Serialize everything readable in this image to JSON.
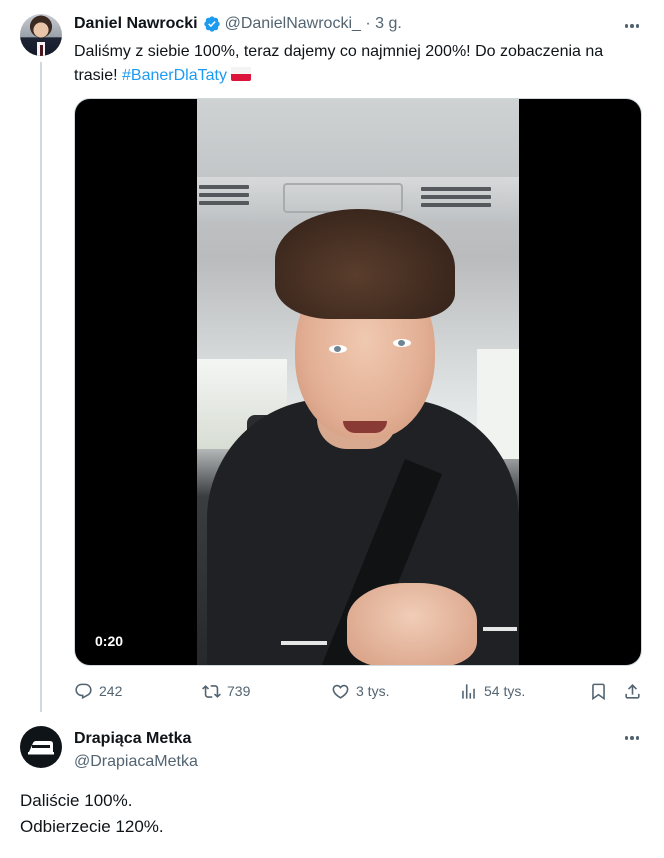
{
  "tweet": {
    "author_name": "Daniel Nawrocki",
    "author_handle": "@DanielNawrocki_",
    "separator": " · ",
    "time": "3 g.",
    "text_before": "Daliśmy z siebie 100%, teraz dajemy co najmniej 200%! Do zobaczenia na trasie! ",
    "hashtag": "#BanerDlaTaty",
    "video": {
      "timestamp": "0:20"
    },
    "actions": {
      "replies": "242",
      "reposts": "739",
      "likes": "3 tys.",
      "views": "54 tys."
    }
  },
  "reply": {
    "author_name": "Drapiąca Metka",
    "author_handle": "@DrapiacaMetka",
    "line1": "Daliście 100%.",
    "line2": "Odbierzecie 120%."
  },
  "colors": {
    "link": "#1d9bf0",
    "muted": "#536471",
    "text": "#0f1419",
    "verified": "#1d9bf0"
  },
  "icons": {
    "verified": "verified-badge-icon",
    "more": "more-dots-icon",
    "reply": "reply-bubble-icon",
    "repost": "repost-arrows-icon",
    "like": "heart-icon",
    "views": "bar-chart-icon",
    "bookmark": "bookmark-icon",
    "share": "share-upload-icon",
    "flag": "poland-flag-icon",
    "iron": "iron-logo-icon"
  }
}
